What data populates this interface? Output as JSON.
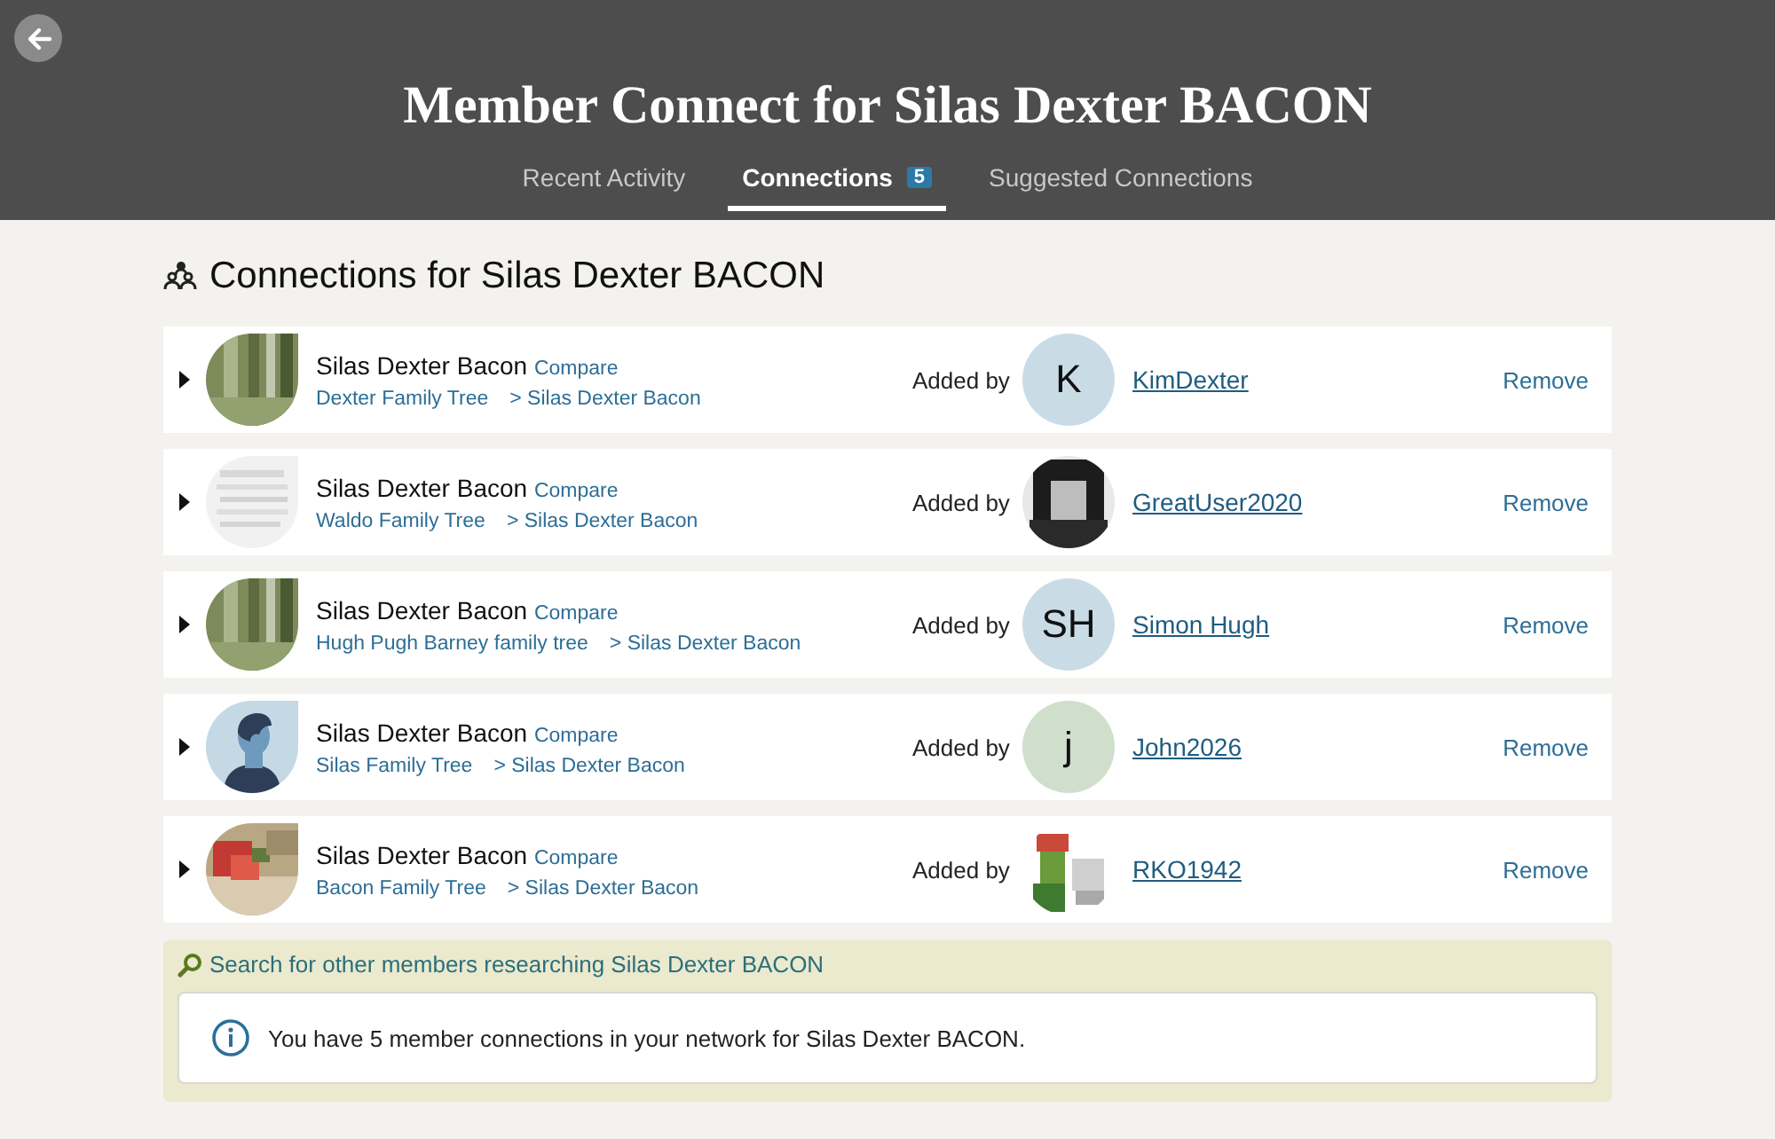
{
  "header": {
    "title": "Member Connect for Silas Dexter BACON"
  },
  "tabs": [
    {
      "label": "Recent Activity",
      "selected": false
    },
    {
      "label": "Connections",
      "selected": true,
      "count": "5"
    },
    {
      "label": "Suggested Connections",
      "selected": false
    }
  ],
  "heading": "Connections for Silas Dexter BACON",
  "connections": [
    {
      "expanded": false,
      "name": "Silas Dexter Bacon",
      "compare": "Compare",
      "tree": "Dexter Family Tree",
      "person": "> Silas Dexter Bacon",
      "added_by": "Added by",
      "adder": {
        "kind": "initials",
        "initials": "K",
        "color": "#c9dce6"
      },
      "user": "KimDexter",
      "action": "Remove"
    },
    {
      "expanded": false,
      "name": "Silas Dexter Bacon",
      "compare": "Compare",
      "tree": "Waldo Family Tree",
      "person": "> Silas Dexter Bacon",
      "added_by": "Added by",
      "user": "GreatUser2020",
      "action": "Remove"
    },
    {
      "expanded": false,
      "name": "Silas Dexter Bacon",
      "compare": "Compare",
      "tree": "Hugh Pugh Barney family tree",
      "person": "> Silas Dexter Bacon",
      "added_by": "Added by",
      "adder": {
        "kind": "initials",
        "initials": "SH",
        "color": "#c9dce6"
      },
      "user": "Simon Hugh",
      "action": "Remove"
    },
    {
      "expanded": false,
      "thumb": {
        "kind": "silhouette"
      },
      "name": "Silas Dexter Bacon",
      "compare": "Compare",
      "tree": "Silas Family Tree",
      "person": "> Silas Dexter Bacon",
      "added_by": "Added by",
      "adder": {
        "kind": "initials",
        "initials": "j",
        "color": "#cfdfcb"
      },
      "user": "John2026",
      "action": "Remove"
    },
    {
      "expanded": false,
      "name": "Silas Dexter Bacon",
      "compare": "Compare",
      "tree": "Bacon Family Tree",
      "person": "> Silas Dexter Bacon",
      "added_by": "Added by",
      "user": "RKO1942",
      "action": "Remove"
    }
  ],
  "search_link": "Search for other members researching Silas Dexter BACON",
  "info": "You have 5 member connections in your network for Silas Dexter BACON."
}
